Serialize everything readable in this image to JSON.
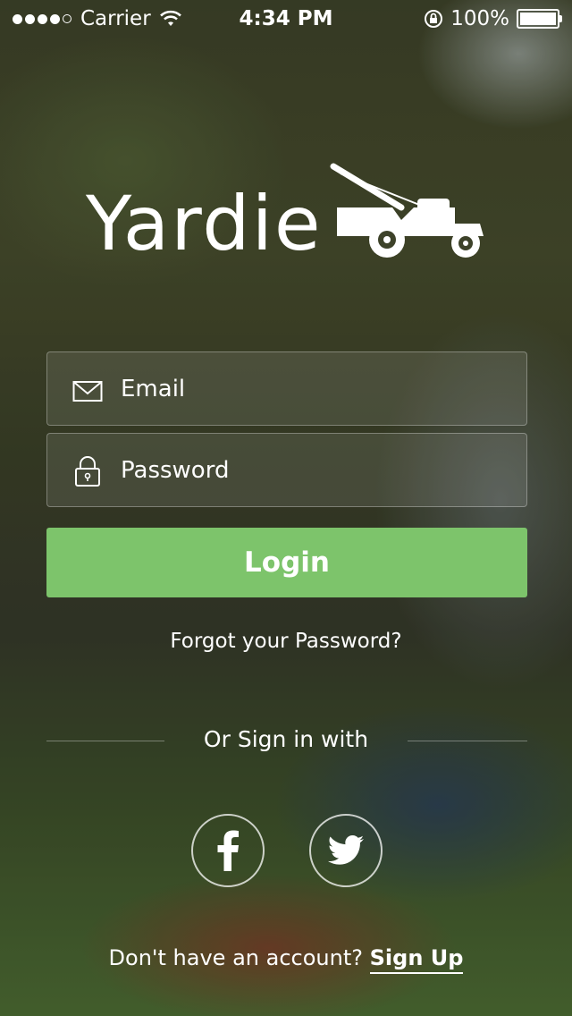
{
  "status_bar": {
    "carrier": "Carrier",
    "time": "4:34 PM",
    "battery": "100%"
  },
  "brand": {
    "name": "Yardie",
    "accent_color": "#7dc46b"
  },
  "form": {
    "email_placeholder": "Email",
    "email_icon": "envelope-icon",
    "password_placeholder": "Password",
    "password_icon": "lock-icon",
    "login_label": "Login",
    "forgot_label": "Forgot your Password?"
  },
  "social": {
    "divider_label": "Or Sign in with",
    "buttons": [
      {
        "name": "facebook",
        "icon": "facebook-icon"
      },
      {
        "name": "twitter",
        "icon": "twitter-icon"
      }
    ]
  },
  "signup": {
    "prompt": "Don't have an account?",
    "link": "Sign Up"
  }
}
